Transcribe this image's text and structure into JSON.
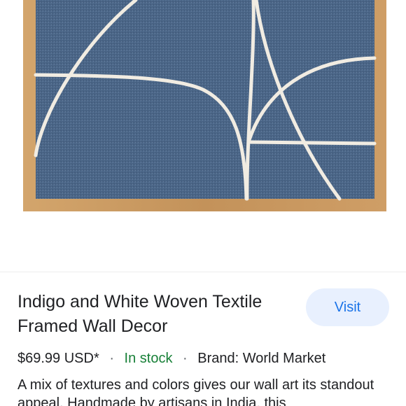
{
  "product": {
    "title": "Indigo and White Woven Textile Framed Wall Decor",
    "visit_label": "Visit",
    "price": "$69.99 USD*",
    "separator": "·",
    "stock_status": "In stock",
    "brand": "Brand: World Market",
    "description": "A mix of textures and colors gives our wall art its standout appeal. Handmade by artisans in India, this"
  },
  "colors": {
    "visit_button_bg": "#e8f0fe",
    "visit_button_text": "#1a73e8",
    "in_stock": "#188038",
    "textile": "#4a6586",
    "frame": "#c99a62"
  }
}
